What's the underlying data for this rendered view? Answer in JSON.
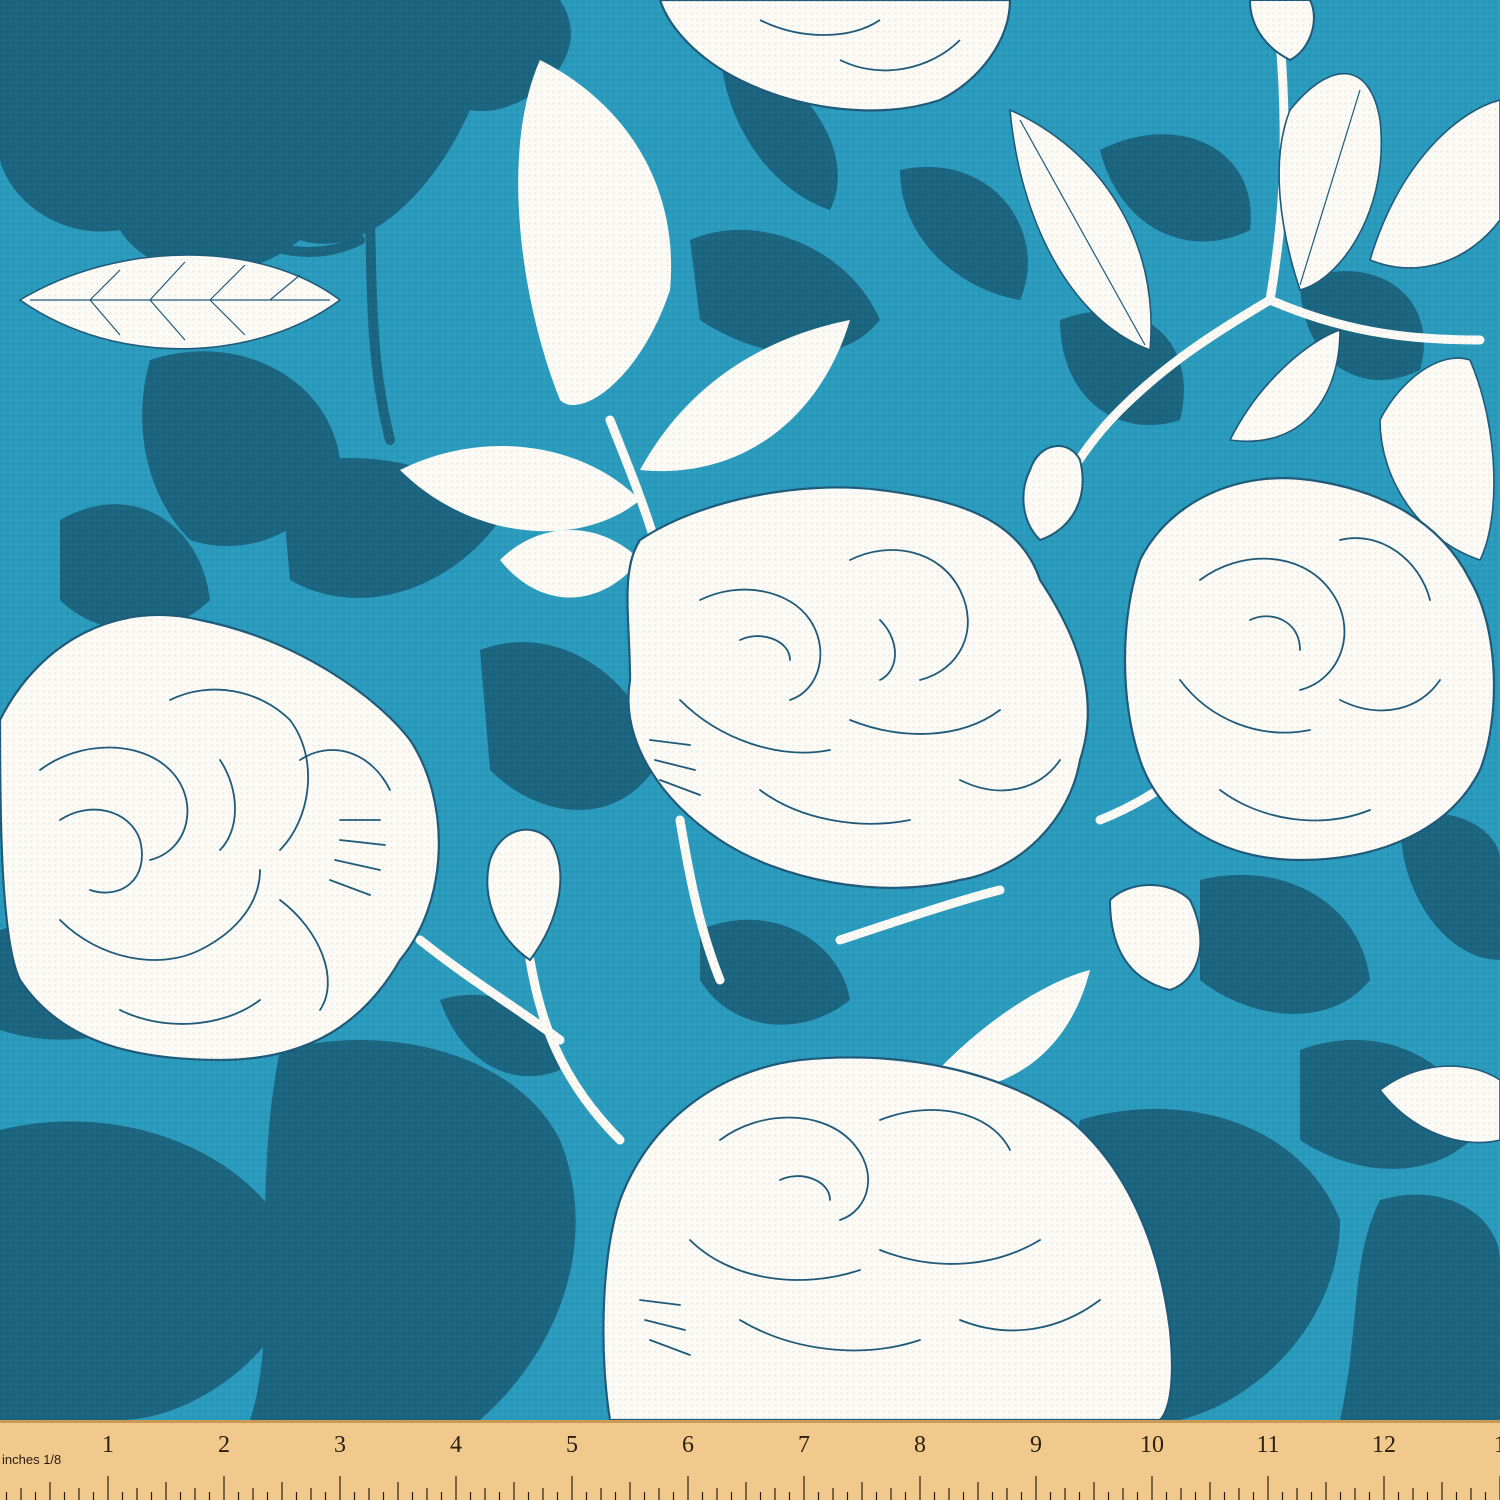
{
  "fabric": {
    "colors": {
      "background": "#2a9bbd",
      "shadow": "#1c6580",
      "petal": "#fbfaf5",
      "line": "#1f5a7a"
    }
  },
  "ruler": {
    "unit_label": "inches 1/8",
    "numbers": [
      "1",
      "2",
      "3",
      "4",
      "5",
      "6",
      "7",
      "8",
      "9",
      "10",
      "11",
      "12",
      "1"
    ],
    "colors": {
      "wood": "#f1c98c",
      "edge": "#c99a55",
      "ink": "#2a2010"
    }
  }
}
